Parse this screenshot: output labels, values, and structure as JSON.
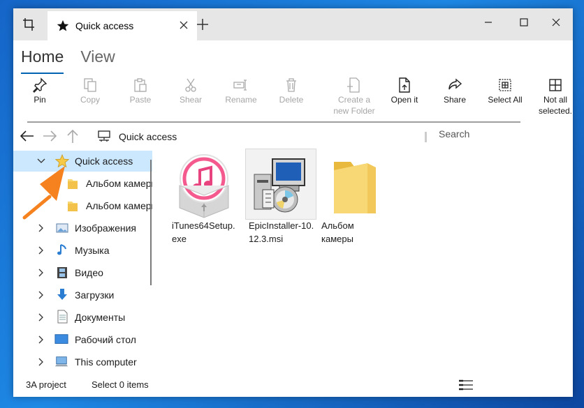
{
  "tab": {
    "title": "Quick access"
  },
  "ribbon_tabs": [
    {
      "label": "Home",
      "active": true
    },
    {
      "label": "View",
      "active": false
    }
  ],
  "commands": {
    "pin": "Pin",
    "copy": "Copy",
    "paste": "Paste",
    "shear": "Shear",
    "rename": "Rename",
    "delete": "Delete",
    "create_folder_1": "Create a",
    "create_folder_2": "new Folder",
    "open": "Open it",
    "share": "Share",
    "select_all": "Select All",
    "not_all_1": "Not all",
    "not_all_2": "selected."
  },
  "address": {
    "location": "Quick access",
    "search_placeholder": "Search"
  },
  "nav": {
    "quick_access": "Quick access",
    "album1": "Альбом камеры",
    "album2": "Альбом камеры",
    "images": "Изображения",
    "music": "Музыка",
    "video": "Видео",
    "downloads": "Загрузки",
    "documents": "Документы",
    "desktop": "Рабочий стол",
    "this_computer": "This computer"
  },
  "files": {
    "itunes_1": "iTunes64Setup.",
    "itunes_2": "exe",
    "epic_1": "EpicInstaller-10.",
    "epic_2": "12.3.msi",
    "album_1": "Альбом",
    "album_2": "камеры"
  },
  "status": {
    "count": "3A project",
    "selected": "Select 0 items"
  },
  "colors": {
    "accent": "#0063b1",
    "selection": "#cce8ff",
    "arrow": "#f5821f",
    "folder": "#f8d775"
  }
}
